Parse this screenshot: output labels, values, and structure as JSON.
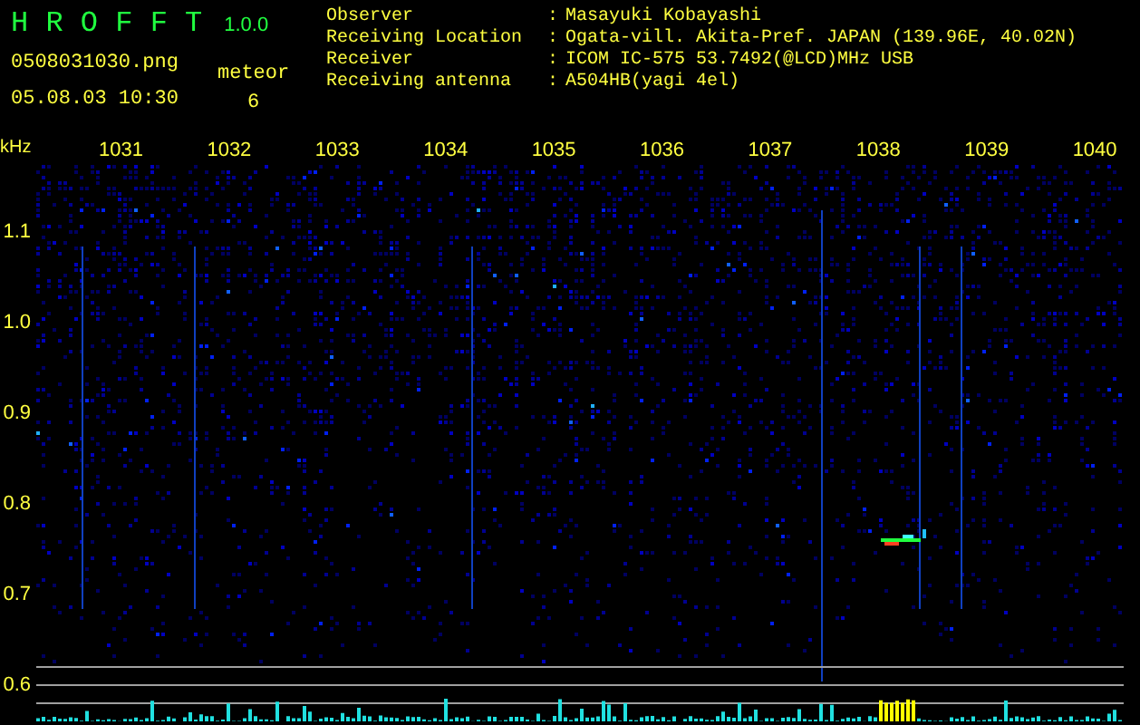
{
  "app": {
    "title": "H R O F F T",
    "version": "1.0.0"
  },
  "file": {
    "name": "0508031030.png",
    "timestamp": "05.08.03 10:30"
  },
  "counter": {
    "label": "meteor",
    "value": "6"
  },
  "info": [
    {
      "label": "Observer",
      "separator": ":",
      "value": "Masayuki Kobayashi"
    },
    {
      "label": "Receiving Location",
      "separator": ":",
      "value": "Ogata-vill. Akita-Pref. JAPAN (139.96E, 40.02N)"
    },
    {
      "label": "Receiver",
      "separator": ":",
      "value": "ICOM IC-575 53.7492(@LCD)MHz USB"
    },
    {
      "label": "Receiving antenna",
      "separator": ":",
      "value": "A504HB(yagi 4el)"
    }
  ],
  "spectrogram": {
    "y_unit": "kHz",
    "y_labels": [
      "1.1",
      "1.0",
      "0.9",
      "0.8",
      "0.7",
      "0.6"
    ],
    "x_labels": [
      "1031",
      "1032",
      "1033",
      "1034",
      "1035",
      "1036",
      "1037",
      "1038",
      "1039",
      "1040"
    ]
  }
}
